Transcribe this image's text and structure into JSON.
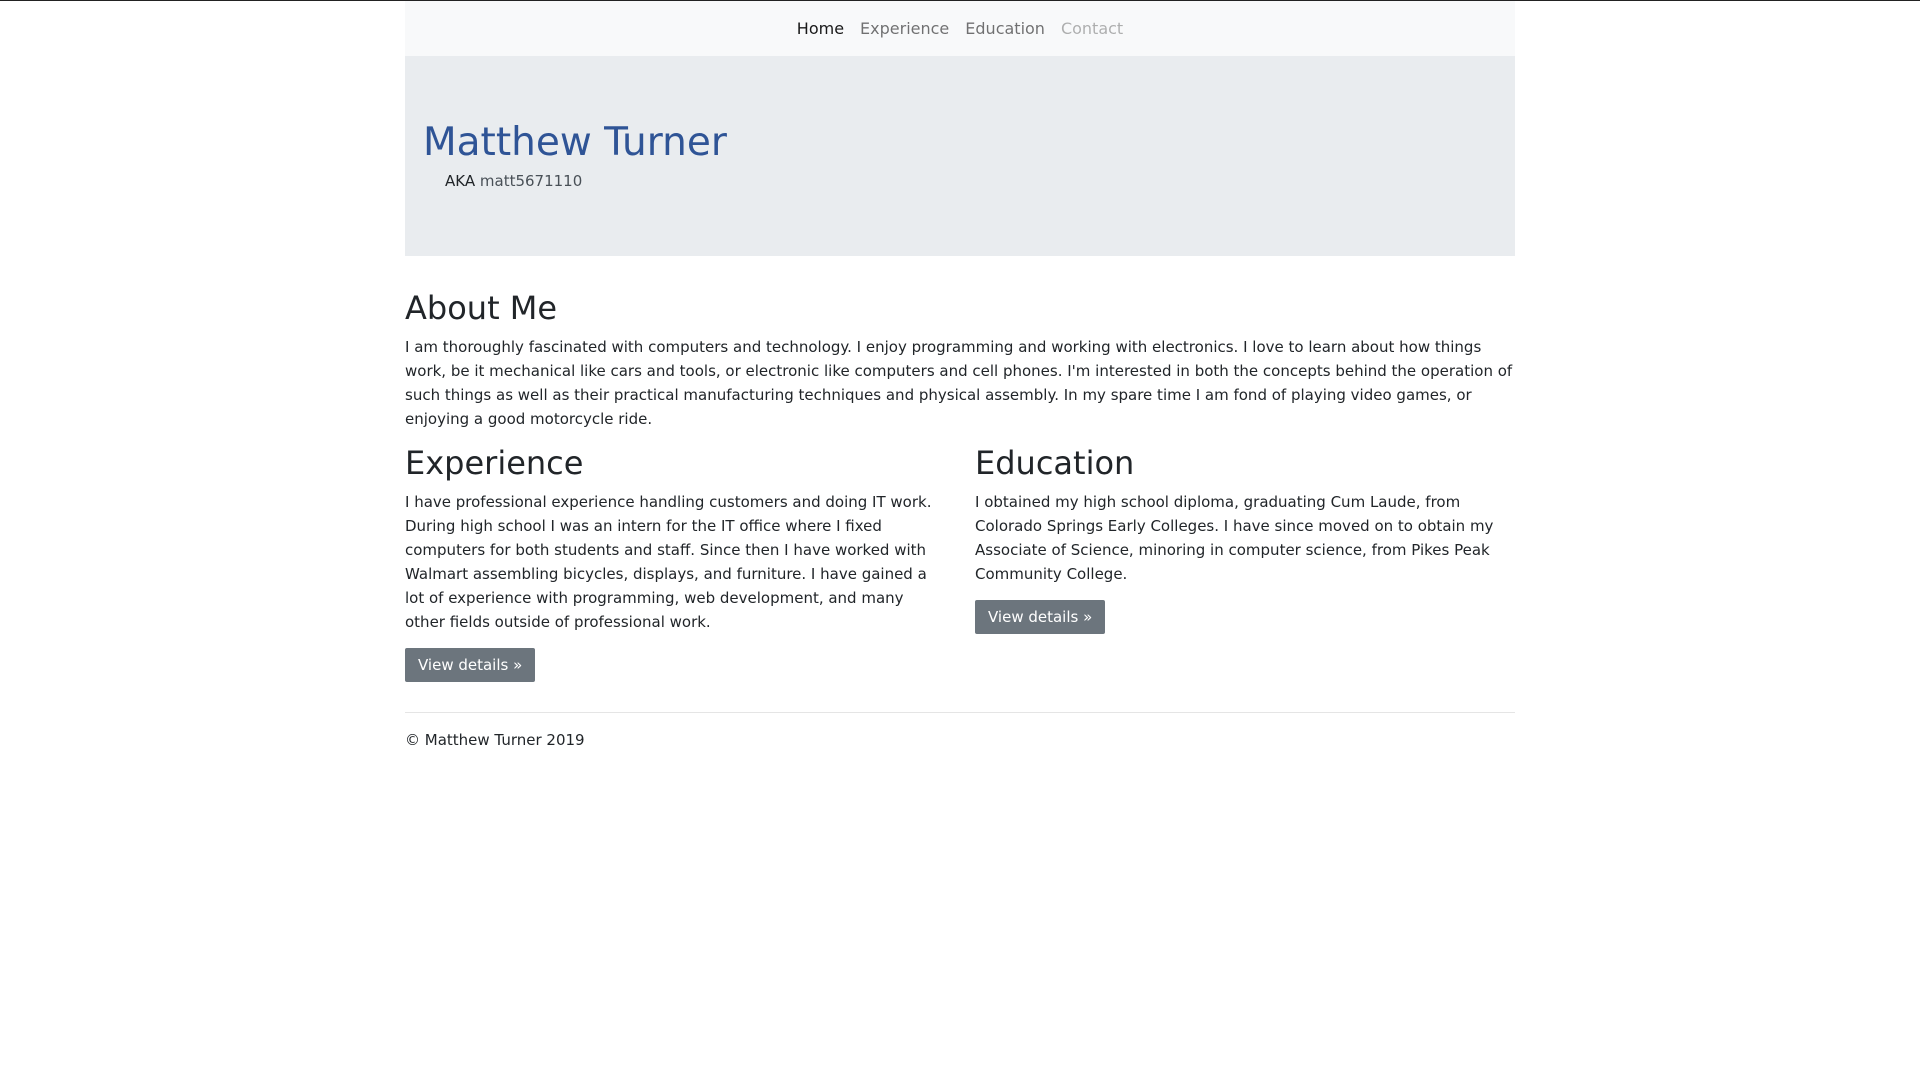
{
  "nav": {
    "items": [
      {
        "label": "Home"
      },
      {
        "label": "Experience"
      },
      {
        "label": "Education"
      },
      {
        "label": "Contact"
      }
    ]
  },
  "jumbotron": {
    "title": "Matthew Turner",
    "aka_label": "AKA",
    "aka_handle": "matt5671110"
  },
  "about": {
    "heading": "About Me",
    "text": "I am thoroughly fascinated with computers and technology. I enjoy programming and working with electronics. I love to learn about how things work, be it mechanical like cars and tools, or electronic like computers and cell phones. I'm interested in both the concepts behind the operation of such things as well as their practical manufacturing techniques and physical assembly. In my spare time I am fond of playing video games, or enjoying a good motorcycle ride."
  },
  "experience": {
    "heading": "Experience",
    "text": "I have professional experience handling customers and doing IT work. During high school I was an intern for the IT office where I fixed computers for both students and staff. Since then I have worked with Walmart assembling bicycles, displays, and furniture. I have gained a lot of experience with programming, web development, and many other fields outside of professional work.",
    "button": "View details »"
  },
  "education": {
    "heading": "Education",
    "text": "I obtained my high school diploma, graduating Cum Laude, from Colorado Springs Early Colleges. I have since moved on to obtain my Associate of Science, minoring in computer science, from Pikes Peak Community College.",
    "button": "View details »"
  },
  "footer": {
    "text": "© Matthew Turner 2019"
  },
  "colors": {
    "title": "#2f5496",
    "button_bg": "#6c757d",
    "jumbotron_bg": "#e9ecef",
    "navbar_bg": "#f8f9fa"
  }
}
